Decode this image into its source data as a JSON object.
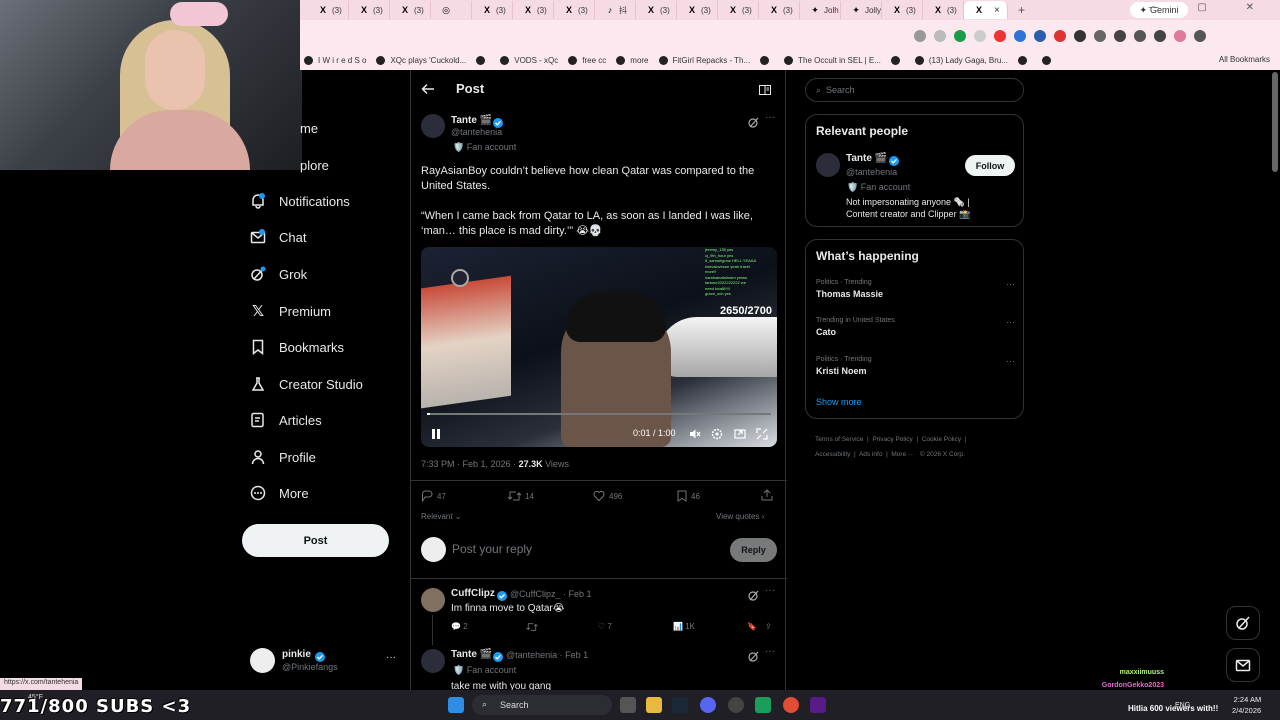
{
  "browser": {
    "tabs": [
      {
        "icon": "X",
        "label": "(3)"
      },
      {
        "icon": "X",
        "label": "(3)"
      },
      {
        "icon": "X",
        "label": "(3)"
      },
      {
        "icon": "◎",
        "label": ""
      },
      {
        "icon": "X",
        "label": "(3)"
      },
      {
        "icon": "X",
        "label": "(3)"
      },
      {
        "icon": "X",
        "label": "(3)"
      },
      {
        "icon": "♪",
        "label": "抖"
      },
      {
        "icon": "X",
        "label": "(3)"
      },
      {
        "icon": "X",
        "label": "(3)"
      },
      {
        "icon": "X",
        "label": "(3)"
      },
      {
        "icon": "X",
        "label": "(3)"
      },
      {
        "icon": "✦",
        "label": "Jolh"
      },
      {
        "icon": "✦",
        "label": "Jolly"
      },
      {
        "icon": "X",
        "label": "(3)"
      },
      {
        "icon": "X",
        "label": "(3)"
      }
    ],
    "active_tab": {
      "icon": "X",
      "close": "×"
    },
    "new_tab": "+",
    "gemini_label": "Gemini",
    "window_controls": "— ▢ ✕",
    "bookmarks": [
      "I W i r e d   S o",
      "XQc plays 'Cuckold...",
      "",
      "VODS - xQc",
      "free cc",
      "more",
      "FitGirl Repacks - Th...",
      "",
      "The Occult in SEL | E...",
      "",
      "(13) Lady Gaga, Bru...",
      "",
      ""
    ],
    "all_bookmarks": "All Bookmarks",
    "status_link": "https://x.com/tantehenia"
  },
  "nav": {
    "items": [
      {
        "label": "me"
      },
      {
        "label": "plore"
      },
      {
        "label": "Notifications"
      },
      {
        "label": "Chat"
      },
      {
        "label": "Grok"
      },
      {
        "label": "Premium"
      },
      {
        "label": "Bookmarks"
      },
      {
        "label": "Creator Studio"
      },
      {
        "label": "Articles"
      },
      {
        "label": "Profile"
      },
      {
        "label": "More"
      }
    ],
    "post_button": "Post",
    "account": {
      "name": "pinkie",
      "handle": "@Pinkiefangs",
      "more": "···"
    }
  },
  "main": {
    "header_title": "Post",
    "tweet": {
      "name": "Tante 🎬",
      "handle": "@tantehenia",
      "badge": "Fan account",
      "text1": "RayAsianBoy couldn’t believe how clean Qatar was compared to the United States.",
      "text2": "“When I came back from Qatar to LA, as soon as I landed I was like, ‘man… this place is mad dirty.’” 😭💀",
      "video": {
        "counter": "2650/2700",
        "time": "0:01 / 1:00",
        "progress": 0.01,
        "chat_lines": [
          "jeremy_135  yes",
          "cj_9th_hour  yes",
          "lt_samuelgonz  HELL YEAAA",
          "kimvaloveson  yeah travel",
          "more!!",
          "naminanatalmam  yesss",
          "tartone2022222222  we",
          "need totalll!!!!!",
          "grace_sch  yes"
        ]
      },
      "timestamp": "7:33 PM · Feb 1, 2026 · ",
      "views_count": "27.3K",
      "views_label": " Views",
      "replies": "47",
      "retweets": "14",
      "likes": "496",
      "bookmarks": "46",
      "relevant": "Relevant",
      "view_quotes": "View quotes"
    },
    "reply_placeholder": "Post your reply",
    "reply_button": "Reply",
    "comments": [
      {
        "name": "CuffClipz",
        "handle": "@CuffClipz_ · Feb 1",
        "text": "Im finna move to Qatar😭",
        "replies": "2",
        "retweets": "",
        "likes": "7",
        "views": "1K"
      },
      {
        "name": "Tante 🎬",
        "handle": "@tantehenia · Feb 1",
        "badge": "Fan account",
        "text": "take me with you gang"
      }
    ]
  },
  "right": {
    "search_placeholder": "Search",
    "relevant_people_title": "Relevant people",
    "person": {
      "name": "Tante 🎬",
      "handle": "@tantehenia",
      "badge": "Fan account",
      "bio": "Not impersonating anyone 🗞️ | Content creator and Clipper 📸",
      "follow": "Follow"
    },
    "whats_happening_title": "What’s happening",
    "trends": [
      {
        "category": "Politics · Trending",
        "title": "Thomas Massie"
      },
      {
        "category": "Trending in United States",
        "title": "Cato"
      },
      {
        "category": "Politics · Trending",
        "title": "Kristi Noem"
      }
    ],
    "show_more": "Show more",
    "footer": [
      "Terms of Service",
      "Privacy Policy",
      "Cookie Policy",
      "Accessibility",
      "Ads info",
      "More ···",
      "© 2026 X Corp."
    ]
  },
  "stream": {
    "subs": "771/800 SUBS <3",
    "temperature": "45°F",
    "chat": [
      {
        "user": "maxxiimuuss",
        "color": "#b6f27a"
      },
      {
        "user": "GordonGekko2023",
        "color": "#e46bd1"
      },
      {
        "user": "maxxiimuuss",
        "color": "#b6f27a"
      }
    ],
    "viewers": "Hitlia 600 viewers with!!"
  },
  "taskbar": {
    "search": "Search",
    "lang": "ENG",
    "time": "2:24 AM",
    "date": "2/4/2026"
  },
  "colors": {
    "accent": "#1d9bf0",
    "tab_bar": "#f6dbe4",
    "background": "#000000",
    "border": "#2f3336"
  }
}
